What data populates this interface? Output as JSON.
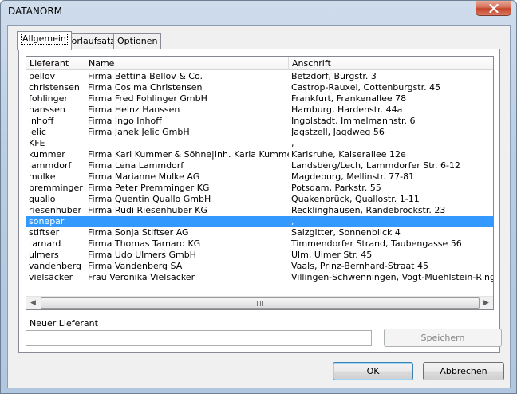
{
  "window": {
    "title": "DATANORM"
  },
  "tabs": [
    {
      "label": "Allgemein"
    },
    {
      "label": "Vorlaufsatz"
    },
    {
      "label": "Optionen"
    }
  ],
  "list": {
    "columns": [
      "Lieferant",
      "Name",
      "Anschrift"
    ],
    "rows": [
      [
        "bellov",
        "Firma Bettina Bellov & Co.",
        "Betzdorf, Burgstr. 3"
      ],
      [
        "christensen",
        "Firma Cosima Christensen",
        "Castrop-Rauxel, Cottenburgstr. 45"
      ],
      [
        "fohlinger",
        "Firma Fred Fohlinger GmbH",
        "Frankfurt, Frankenallee 78"
      ],
      [
        "hanssen",
        "Firma Heinz Hanssen",
        "Hamburg, Hardenstr. 44a"
      ],
      [
        "inhoff",
        "Firma Ingo Inhoff",
        "Ingolstadt, Immelmannstr. 6"
      ],
      [
        "jelic",
        "Firma Janek Jelic GmbH",
        "Jagstzell, Jagdweg 56"
      ],
      [
        "KFE",
        "",
        ","
      ],
      [
        "kummer",
        "Firma Karl Kummer & Söhne|Inh. Karla Kummer",
        "Karlsruhe, Kaiserallee 12e"
      ],
      [
        "lammdorf",
        "Firma Lena Lammdorf",
        "Landsberg/Lech, Lammdorfer Str. 6-12"
      ],
      [
        "mulke",
        "Firma Marianne Mulke AG",
        "Magdeburg, Mellinstr. 77-81"
      ],
      [
        "premminger",
        "Firma Peter Premminger KG",
        "Potsdam, Parkstr. 55"
      ],
      [
        "quallo",
        "Firma Quentin Quallo GmbH",
        "Quakenbrück, Quallostr. 1-11"
      ],
      [
        "riesenhuber",
        "Firma Rudi Riesenhuber KG",
        "Recklinghausen, Randebrockstr. 23"
      ],
      [
        "sonepar",
        "",
        ","
      ],
      [
        "stiftser",
        "Firma Sonja Stiftser AG",
        "Salzgitter, Sonnenblick 4"
      ],
      [
        "tarnard",
        "Firma Thomas Tarnard KG",
        "Timmendorfer Strand, Taubengasse 56"
      ],
      [
        "ulmers",
        "Firma Udo Ulmers GmbH",
        "Ulm, Ulmer Str. 45"
      ],
      [
        "vandenberg",
        "Firma Vandenberg SA",
        "Vaals, Prinz-Bernhard-Straat 45"
      ],
      [
        "vielsäcker",
        "Frau Veronika Vielsäcker",
        "Villingen-Schwenningen, Vogt-Muehlstein-Ring 2"
      ]
    ],
    "selected_index": 13
  },
  "new_supplier": {
    "label": "Neuer Lieferant",
    "value": ""
  },
  "buttons": {
    "save": "Speichern",
    "ok": "OK",
    "cancel": "Abbrechen"
  },
  "colors": {
    "selection": "#3399ff"
  }
}
